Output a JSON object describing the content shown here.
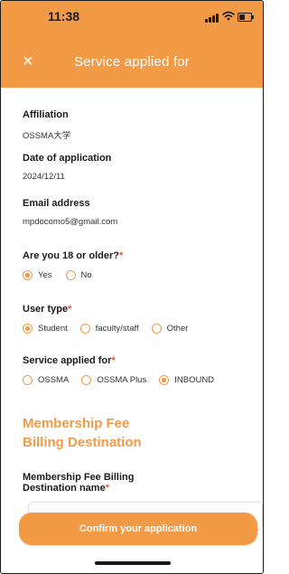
{
  "status_bar": {
    "time": "11:38"
  },
  "header": {
    "title": "Service applied for",
    "close_icon": "×"
  },
  "fields": {
    "affiliation": {
      "label": "Affiliation",
      "value": "OSSMA大学"
    },
    "date": {
      "label": "Date of application",
      "value": "2024/12/11"
    },
    "email": {
      "label": "Email address",
      "value": "mpdocomo5@gmail.com"
    }
  },
  "age": {
    "label": "Are you 18 or older?",
    "required": "*",
    "options": [
      {
        "label": "Yes",
        "selected": true
      },
      {
        "label": "No",
        "selected": false
      }
    ]
  },
  "user_type": {
    "label": "User type",
    "required": "*",
    "options": [
      {
        "label": "Student",
        "selected": true
      },
      {
        "label": "faculty/staff",
        "selected": false
      },
      {
        "label": "Other",
        "selected": false
      }
    ]
  },
  "service": {
    "label": "Service applied for",
    "required": "*",
    "options": [
      {
        "label": "OSSMA",
        "selected": false
      },
      {
        "label": "OSSMA Plus",
        "selected": false
      },
      {
        "label": "INBOUND",
        "selected": true
      }
    ]
  },
  "billing": {
    "section_line1": "Membership Fee",
    "section_line2": "Billing Destination",
    "name_label_line1": "Membership Fee Billing",
    "name_label_line2": "Destination name",
    "required": "*"
  },
  "confirm_label": "Confirm your application",
  "colors": {
    "accent": "#F39A46",
    "required": "#E05A3A"
  }
}
